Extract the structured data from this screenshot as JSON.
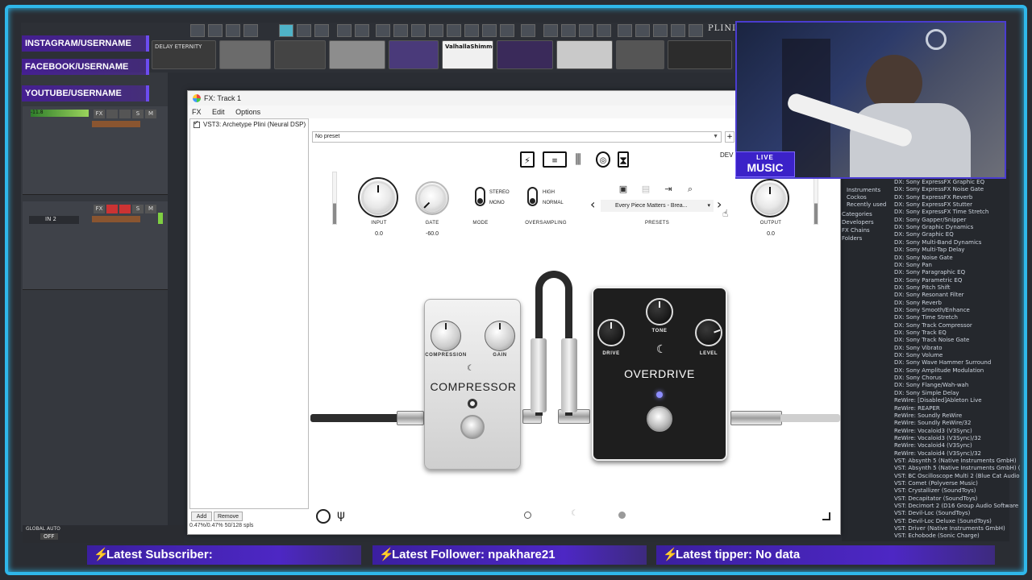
{
  "social": {
    "instagram": "INSTAGRAM/USERNAME",
    "facebook": "FACEBOOK/USERNAME",
    "youtube": "YOUTUBE/USERNAME"
  },
  "daw": {
    "plugin_thumbs": [
      "DELAY ETERNITY",
      "ValhallaShimmer"
    ],
    "track1_meter": "-11.8",
    "track2_input": "IN 2",
    "global_auto": "GLOBAL AUTO",
    "global_auto_value": "OFF",
    "vendor_logo": "PLINI",
    "browser_categories": [
      "Instruments",
      "Cockos",
      "Recently used",
      "Categories",
      "Developers",
      "FX Chains",
      "Folders"
    ],
    "browser_items": [
      "DX: Sony ExpressFX Graphic EQ",
      "DX: Sony ExpressFX Noise Gate",
      "DX: Sony ExpressFX Reverb",
      "DX: Sony ExpressFX Stutter",
      "DX: Sony ExpressFX Time Stretch",
      "DX: Sony Gapper/Snipper",
      "DX: Sony Graphic Dynamics",
      "DX: Sony Graphic EQ",
      "DX: Sony Multi-Band Dynamics",
      "DX: Sony Multi-Tap Delay",
      "DX: Sony Noise Gate",
      "DX: Sony Pan",
      "DX: Sony Paragraphic EQ",
      "DX: Sony Parametric EQ",
      "DX: Sony Pitch Shift",
      "DX: Sony Resonant Filter",
      "DX: Sony Reverb",
      "DX: Sony Smooth/Enhance",
      "DX: Sony Time Stretch",
      "DX: Sony Track Compressor",
      "DX: Sony Track EQ",
      "DX: Sony Track Noise Gate",
      "DX: Sony Vibrato",
      "DX: Sony Volume",
      "DX: Sony Wave Hammer Surround",
      "DX: Sony Amplitude Modulation",
      "DX: Sony Chorus",
      "DX: Sony Flange/Wah-wah",
      "DX: Sony Simple Delay",
      "ReWire: [Disabled]Ableton Live",
      "ReWire: REAPER",
      "ReWire: Soundly ReWire",
      "ReWire: Soundly ReWire/32",
      "ReWire: Vocaloid3 (V3Sync)",
      "ReWire: Vocaloid3 (V3Sync)/32",
      "ReWire: Vocaloid4 (V3Sync)",
      "ReWire: Vocaloid4 (V3Sync)/32",
      "VST: Absynth 5 (Native Instruments GmbH)",
      "VST: Absynth 5 (Native Instruments GmbH) (",
      "VST: BC Oscilloscope Multi 2 (Blue Cat Audio",
      "VST: Comet (Polyverse Music)",
      "VST: Crystallizer (SoundToys)",
      "VST: Decapitator (SoundToys)",
      "VST: Decimort 2 (D16 Group Audio Software",
      "VST: Devil-Loc (SoundToys)",
      "VST: Devil-Loc Deluxe (SoundToys)",
      "VST: Driver (Native Instruments GmbH)",
      "VST: Echobode (Sonic Charge)"
    ]
  },
  "fx_window": {
    "title": "FX: Track 1",
    "menu": [
      "FX",
      "Edit",
      "Options"
    ],
    "chain_entry": "VST3: Archetype Plini (Neural DSP)",
    "add_label": "Add",
    "remove_label": "Remove",
    "cpu_info": "0.47%/0.47% 50/128 spls",
    "preset_value": "No preset",
    "preset_plus": "+"
  },
  "plugin": {
    "dev_label": "DEV",
    "input_label": "INPUT",
    "input_value": "0.0",
    "gate_label": "GATE",
    "gate_value": "-60.0",
    "mode_label": "MODE",
    "mode_options": [
      "STEREO",
      "MONO"
    ],
    "oversampling_label": "OVERSAMPLING",
    "oversampling_options": [
      "HIGH",
      "NORMAL"
    ],
    "presets_label": "PRESETS",
    "preset_name": "Every Piece Matters - Brea...",
    "output_label": "OUTPUT",
    "output_value": "0.0",
    "compressor": {
      "name": "COMPRESSOR",
      "knob1": "COMPRESSION",
      "knob2": "GAIN"
    },
    "overdrive": {
      "name": "OVERDRIVE",
      "knob1": "DRIVE",
      "knob2": "TONE",
      "knob3": "LEVEL"
    }
  },
  "overlay": {
    "live": "LIVE",
    "music": "MUSIC",
    "latest_subscriber": "Latest Subscriber:",
    "latest_follower": "Latest Follower: npakhare21",
    "latest_tipper": "Latest tipper: No data"
  },
  "colors": {
    "frame": "#2fb7ea",
    "overlay_purple": "#4d27c4",
    "bolt": "#6bc8ff"
  }
}
